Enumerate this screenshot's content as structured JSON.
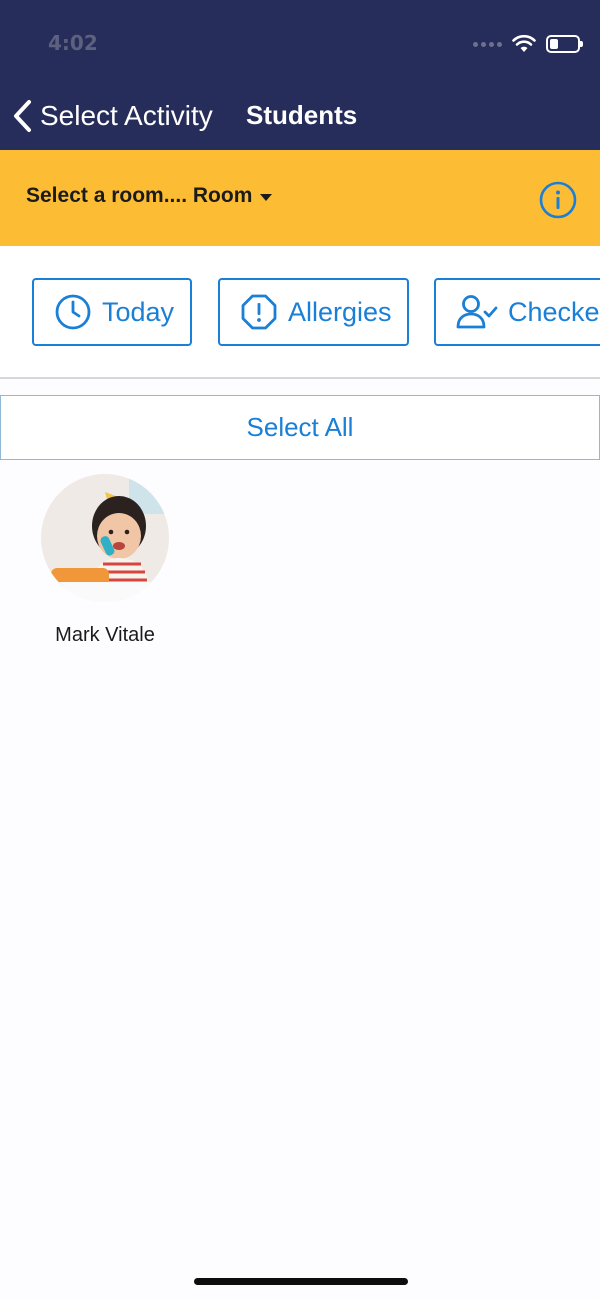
{
  "status_bar": {
    "time": "4:02"
  },
  "nav": {
    "back_label": "Select Activity",
    "title": "Students"
  },
  "room_bar": {
    "select_label": "Select a room.... Room",
    "info_icon": "info-icon"
  },
  "filters": [
    {
      "label": "Today",
      "icon": "clock-icon"
    },
    {
      "label": "Allergies",
      "icon": "alert-octagon-icon"
    },
    {
      "label": "Checked",
      "icon": "user-check-icon"
    }
  ],
  "select_all_label": "Select All",
  "students": [
    {
      "name": "Mark Vitale"
    }
  ],
  "colors": {
    "header_bg": "#272d5a",
    "room_bar_bg": "#fcbd34",
    "accent": "#1a7fd6"
  }
}
